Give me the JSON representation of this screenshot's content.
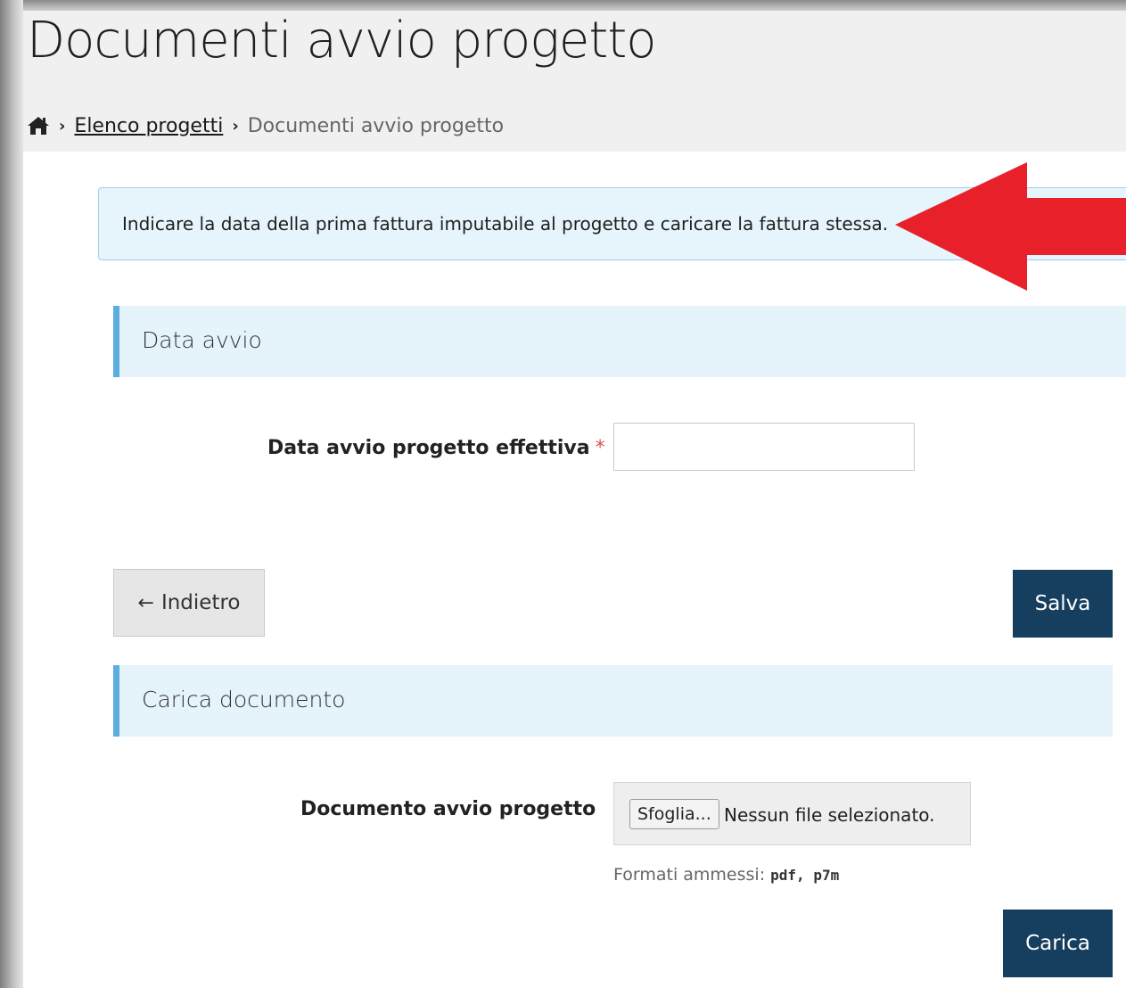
{
  "page": {
    "title": "Documenti avvio progetto"
  },
  "breadcrumb": {
    "home_icon": "home-icon",
    "items": [
      {
        "label": "Elenco progetti",
        "link": true
      },
      {
        "label": "Documenti avvio progetto",
        "link": false
      }
    ]
  },
  "alert": {
    "text": "Indicare la data della prima fattura imputabile al progetto e caricare la fattura stessa.",
    "annotation_color": "#e8202a"
  },
  "section_data_avvio": {
    "title": "Data avvio",
    "field_label": "Data avvio progetto effettiva",
    "required_marker": "*",
    "value": ""
  },
  "actions": {
    "back_label": "Indietro",
    "save_label": "Salva"
  },
  "section_documento": {
    "title": "Carica documento",
    "field_label": "Documento avvio progetto",
    "browse_label": "Sfoglia...",
    "file_status": "Nessun file selezionato.",
    "formats_prefix": "Formati ammessi:",
    "formats_value": "pdf, p7m",
    "upload_label": "Carica"
  },
  "colors": {
    "primary_button": "#163e5f",
    "section_accent": "#5aaee0",
    "section_background": "#e5f3fa",
    "alert_background": "#e6f4fb",
    "required": "#d9534f"
  }
}
